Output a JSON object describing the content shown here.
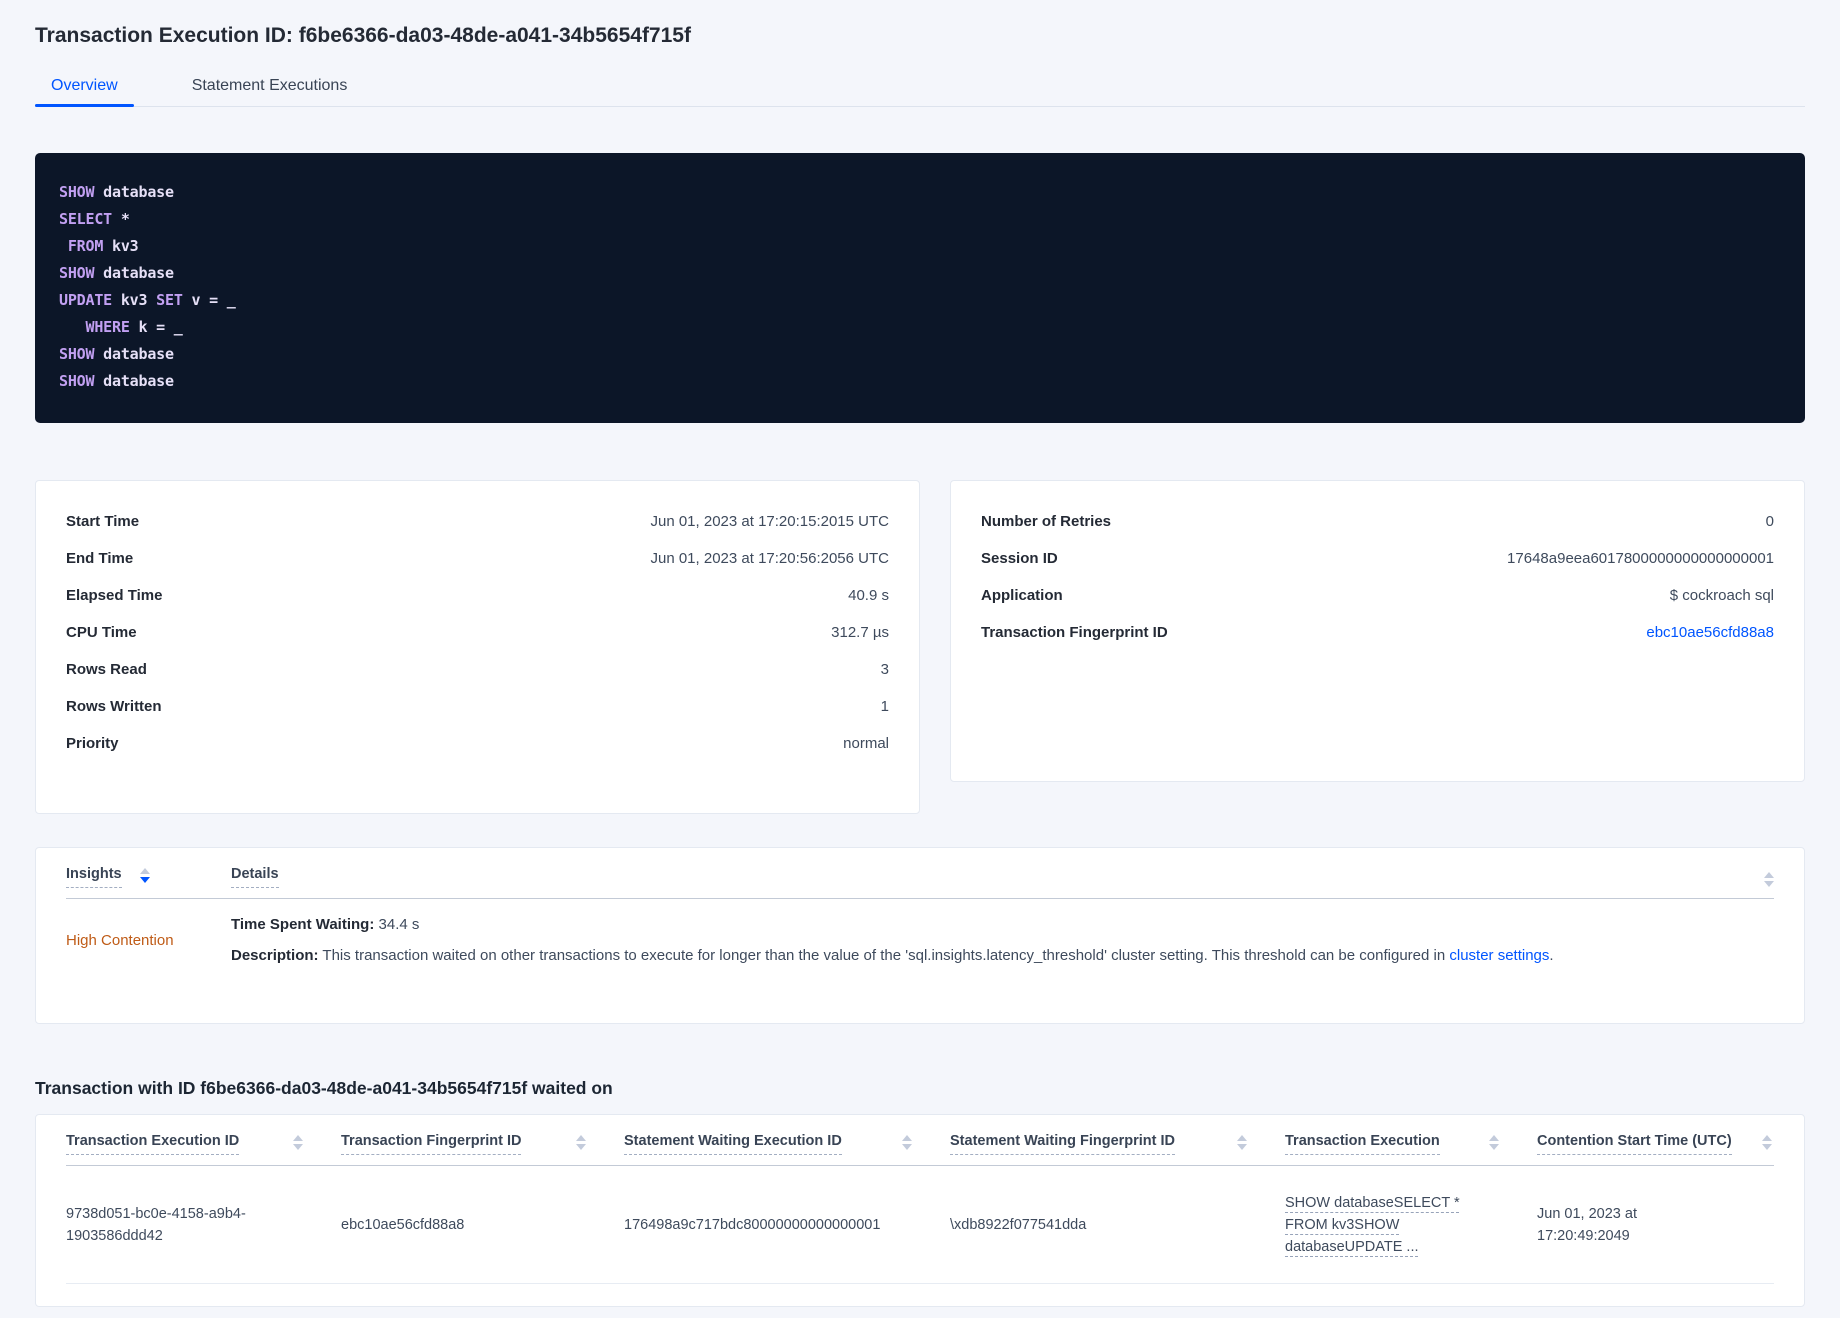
{
  "page": {
    "title": "Transaction Execution ID: f6be6366-da03-48de-a041-34b5654f715f"
  },
  "tabs": {
    "overview": "Overview",
    "statement_executions": "Statement Executions"
  },
  "sql": {
    "lines": [
      [
        {
          "t": "SHOW",
          "c": "kw"
        },
        {
          "t": " database",
          "c": "id"
        }
      ],
      [
        {
          "t": "SELECT",
          "c": "kw"
        },
        {
          "t": " *",
          "c": "id"
        }
      ],
      [
        {
          "t": " ",
          "c": "id"
        },
        {
          "t": "FROM",
          "c": "kw"
        },
        {
          "t": " kv3",
          "c": "id"
        }
      ],
      [
        {
          "t": "SHOW",
          "c": "kw"
        },
        {
          "t": " database",
          "c": "id"
        }
      ],
      [
        {
          "t": "UPDATE",
          "c": "kw"
        },
        {
          "t": " kv3 ",
          "c": "id"
        },
        {
          "t": "SET",
          "c": "kw"
        },
        {
          "t": " v = _",
          "c": "id"
        }
      ],
      [
        {
          "t": "   ",
          "c": "id"
        },
        {
          "t": "WHERE",
          "c": "kw"
        },
        {
          "t": " k = _",
          "c": "id"
        }
      ],
      [
        {
          "t": "SHOW",
          "c": "kw"
        },
        {
          "t": " database",
          "c": "id"
        }
      ],
      [
        {
          "t": "SHOW",
          "c": "kw"
        },
        {
          "t": " database",
          "c": "id"
        }
      ]
    ]
  },
  "summary_left": {
    "rows": [
      {
        "label": "Start Time",
        "value": "Jun 01, 2023 at 17:20:15:2015 UTC"
      },
      {
        "label": "End Time",
        "value": "Jun 01, 2023 at 17:20:56:2056 UTC"
      },
      {
        "label": "Elapsed Time",
        "value": "40.9 s"
      },
      {
        "label": "CPU Time",
        "value": "312.7 µs"
      },
      {
        "label": "Rows Read",
        "value": "3"
      },
      {
        "label": "Rows Written",
        "value": "1"
      },
      {
        "label": "Priority",
        "value": "normal"
      }
    ]
  },
  "summary_right": {
    "rows": [
      {
        "label": "Number of Retries",
        "value": "0"
      },
      {
        "label": "Session ID",
        "value": "17648a9eea6017800000000000000001"
      },
      {
        "label": "Application",
        "value": "$ cockroach sql"
      },
      {
        "label": "Transaction Fingerprint ID",
        "value": "ebc10ae56cfd88a8"
      }
    ]
  },
  "insights": {
    "headers": {
      "insights": "Insights",
      "details": "Details"
    },
    "row": {
      "insight": "High Contention",
      "waiting_label": "Time Spent Waiting:",
      "waiting_value": " 34.4 s",
      "description_label": "Description:",
      "description_text": " This transaction waited on other transactions to execute for longer than the value of the 'sql.insights.latency_threshold' cluster setting. This threshold can be configured in ",
      "description_link": "cluster settings",
      "description_suffix": "."
    }
  },
  "waited_section": {
    "heading": "Transaction with ID f6be6366-da03-48de-a041-34b5654f715f waited on",
    "headers": [
      "Transaction Execution ID",
      "Transaction Fingerprint ID",
      "Statement Waiting Execution ID",
      "Statement Waiting Fingerprint ID",
      "Transaction Execution",
      "Contention Start Time (UTC)"
    ],
    "row": {
      "transaction_execution_id": "9738d051-bc0e-4158-a9b4-1903586ddd42",
      "transaction_fingerprint_id": "ebc10ae56cfd88a8",
      "statement_waiting_execution_id": "176498a9c717bdc80000000000000001",
      "statement_waiting_fingerprint_id": "\\xdb8922f077541dda",
      "transaction_execution": "SHOW databaseSELECT * FROM kv3SHOW databaseUPDATE ...",
      "contention_start_time": "Jun 01, 2023 at 17:20:49:2049"
    }
  },
  "colors": {
    "accent_blue": "#0055ff",
    "high_contention_orange": "#bf5b16",
    "code_background": "#0c1628",
    "code_keyword": "#c2a0f2",
    "code_text": "#e6e0f7",
    "page_background": "#f4f6fb"
  }
}
